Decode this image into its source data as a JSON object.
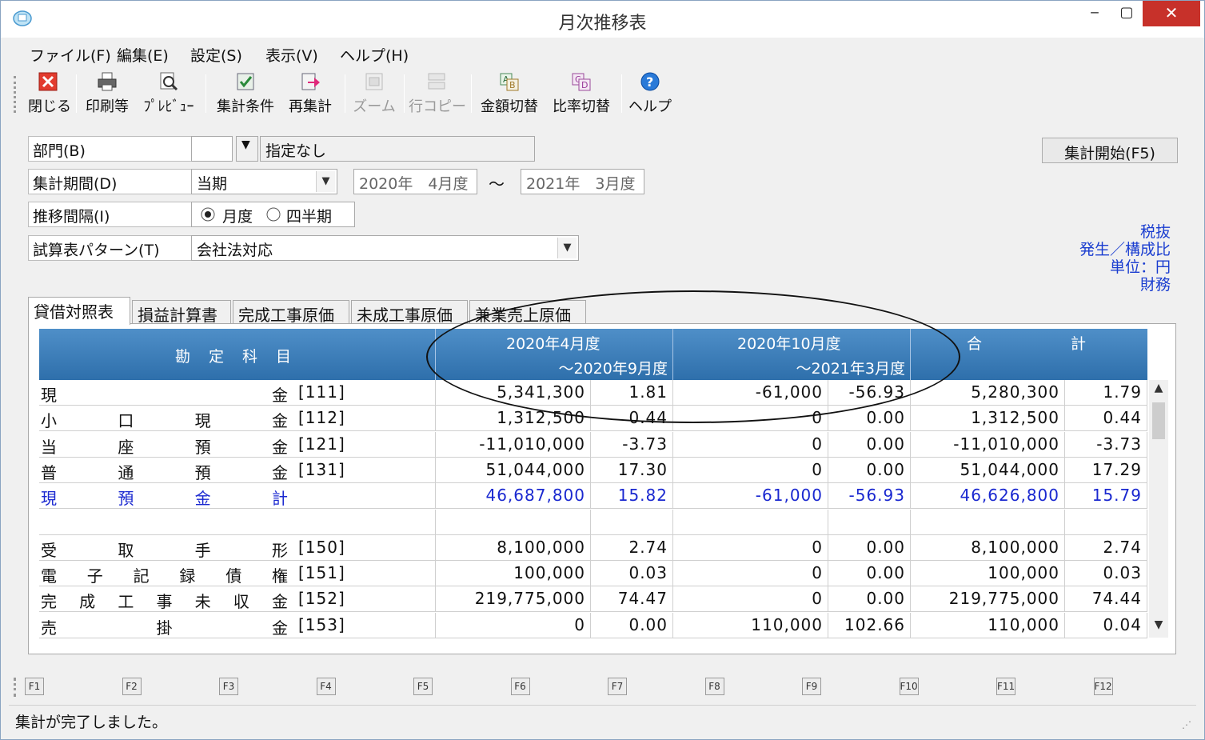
{
  "window": {
    "title": "月次推移表"
  },
  "menu": [
    "ファイル(F)",
    "編集(E)",
    "設定(S)",
    "表示(V)",
    "ヘルプ(H)"
  ],
  "toolbar": [
    {
      "label": "閉じる",
      "icon": "close-icon",
      "enabled": true
    },
    {
      "label": "印刷等",
      "icon": "printer-icon",
      "enabled": true
    },
    {
      "label": "ﾌﾟﾚﾋﾞｭｰ",
      "icon": "preview-icon",
      "enabled": true
    },
    {
      "label": "集計条件",
      "icon": "conditions-icon",
      "enabled": true
    },
    {
      "label": "再集計",
      "icon": "recalc-icon",
      "enabled": true
    },
    {
      "label": "ズーム",
      "icon": "zoom-icon",
      "enabled": false
    },
    {
      "label": "行コピー",
      "icon": "row-copy-icon",
      "enabled": false
    },
    {
      "label": "金額切替",
      "icon": "amount-switch-icon",
      "enabled": true
    },
    {
      "label": "比率切替",
      "icon": "ratio-switch-icon",
      "enabled": true
    },
    {
      "label": "ヘルプ",
      "icon": "help-icon",
      "enabled": true
    }
  ],
  "form": {
    "department_label": "部門(B)",
    "department_code": "",
    "department_name": "指定なし",
    "period_label": "集計期間(D)",
    "period_value": "当期",
    "period_from": "2020年　4月度",
    "period_tilde": "～",
    "period_to": "2021年　3月度",
    "interval_label": "推移間隔(I)",
    "interval_options": [
      "月度",
      "四半期"
    ],
    "interval_selected": "月度",
    "pattern_label": "試算表パターン(T)",
    "pattern_value": "会社法対応",
    "start_button": "集計開始(F5)"
  },
  "info": [
    "税抜",
    "発生／構成比",
    "単位：円",
    "財務"
  ],
  "tabs": [
    "貸借対照表",
    "損益計算書",
    "完成工事原価",
    "未成工事原価",
    "兼業売上原価"
  ],
  "active_tab": "貸借対照表",
  "grid": {
    "header_account": "勘　定　科　目",
    "header_p1_line1": "2020年4月度",
    "header_p1_line2": "～2020年9月度",
    "header_p2_line1": "2020年10月度",
    "header_p2_line2": "～2021年3月度",
    "header_total_left": "合",
    "header_total_right": "計",
    "rows": [
      {
        "name": [
          "現",
          "金"
        ],
        "code": "[111]",
        "v1": "5,341,300",
        "r1": "1.81",
        "v2": "-61,000",
        "r2": "-56.93",
        "vt": "5,280,300",
        "rt": "1.79",
        "blue": false
      },
      {
        "name": [
          "小",
          "口",
          "現",
          "金"
        ],
        "code": "[112]",
        "v1": "1,312,500",
        "r1": "0.44",
        "v2": "0",
        "r2": "0.00",
        "vt": "1,312,500",
        "rt": "0.44",
        "blue": false
      },
      {
        "name": [
          "当",
          "座",
          "預",
          "金"
        ],
        "code": "[121]",
        "v1": "-11,010,000",
        "r1": "-3.73",
        "v2": "0",
        "r2": "0.00",
        "vt": "-11,010,000",
        "rt": "-3.73",
        "blue": false
      },
      {
        "name": [
          "普",
          "通",
          "預",
          "金"
        ],
        "code": "[131]",
        "v1": "51,044,000",
        "r1": "17.30",
        "v2": "0",
        "r2": "0.00",
        "vt": "51,044,000",
        "rt": "17.29",
        "blue": false
      },
      {
        "name": [
          "現",
          "預",
          "金",
          "計"
        ],
        "code": "",
        "v1": "46,687,800",
        "r1": "15.82",
        "v2": "-61,000",
        "r2": "-56.93",
        "vt": "46,626,800",
        "rt": "15.79",
        "blue": true
      },
      {
        "name": [],
        "code": "",
        "v1": "",
        "r1": "",
        "v2": "",
        "r2": "",
        "vt": "",
        "rt": "",
        "blue": false
      },
      {
        "name": [
          "受",
          "取",
          "手",
          "形"
        ],
        "code": "[150]",
        "v1": "8,100,000",
        "r1": "2.74",
        "v2": "0",
        "r2": "0.00",
        "vt": "8,100,000",
        "rt": "2.74",
        "blue": false
      },
      {
        "name": [
          "電",
          "子",
          "記",
          "録",
          "債",
          "権"
        ],
        "code": "[151]",
        "v1": "100,000",
        "r1": "0.03",
        "v2": "0",
        "r2": "0.00",
        "vt": "100,000",
        "rt": "0.03",
        "blue": false
      },
      {
        "name": [
          "完",
          "成",
          "工",
          "事",
          "未",
          "収",
          "金"
        ],
        "code": "[152]",
        "v1": "219,775,000",
        "r1": "74.47",
        "v2": "0",
        "r2": "0.00",
        "vt": "219,775,000",
        "rt": "74.44",
        "blue": false
      },
      {
        "name": [
          "売",
          "掛",
          "金"
        ],
        "code": "[153]",
        "v1": "0",
        "r1": "0.00",
        "v2": "110,000",
        "r2": "102.66",
        "vt": "110,000",
        "rt": "0.04",
        "blue": false
      }
    ]
  },
  "fkeys": [
    "F1",
    "F2",
    "F3",
    "F4",
    "F5",
    "F6",
    "F7",
    "F8",
    "F9",
    "F10",
    "F11",
    "F12"
  ],
  "status": "集計が完了しました。",
  "colors": {
    "header_blue": "#3a7dbd",
    "total_blue": "#1a28d0",
    "close_red": "#c7312a"
  }
}
